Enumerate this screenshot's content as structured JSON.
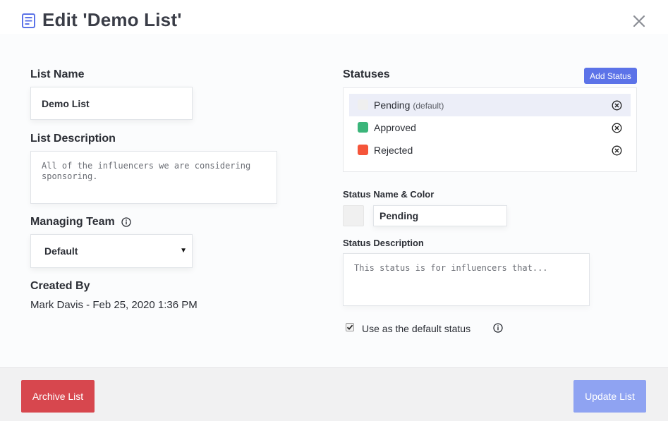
{
  "header": {
    "title": "Edit 'Demo List'",
    "icon": "list-document-icon",
    "close_icon": "close-icon"
  },
  "form": {
    "list_name_label": "List Name",
    "list_name_value": "Demo List",
    "list_description_label": "List Description",
    "list_description_value": "All of the influencers we are considering sponsoring.",
    "managing_team_label": "Managing Team",
    "managing_team_value": "Default",
    "created_by_label": "Created By",
    "created_by_value": "Mark Davis - Feb 25, 2020 1:36 PM"
  },
  "statuses": {
    "label": "Statuses",
    "add_button_label": "Add Status",
    "items": [
      {
        "name": "Pending",
        "default_tag": "(default)",
        "color": "#efefef",
        "selected": true
      },
      {
        "name": "Approved",
        "default_tag": "",
        "color": "#3bb57a",
        "selected": false
      },
      {
        "name": "Rejected",
        "default_tag": "",
        "color": "#f5553a",
        "selected": false
      }
    ]
  },
  "status_editor": {
    "name_color_label": "Status Name & Color",
    "name_value": "Pending",
    "color_value": "#efefef",
    "description_label": "Status Description",
    "description_placeholder": "This status is for influencers that...",
    "default_checkbox_label": "Use as the default status",
    "default_checked": true
  },
  "footer": {
    "archive_label": "Archive List",
    "update_label": "Update List"
  },
  "colors": {
    "accent": "#5c73e8",
    "danger": "#d7474e",
    "update_disabled": "#8fa3f2"
  }
}
